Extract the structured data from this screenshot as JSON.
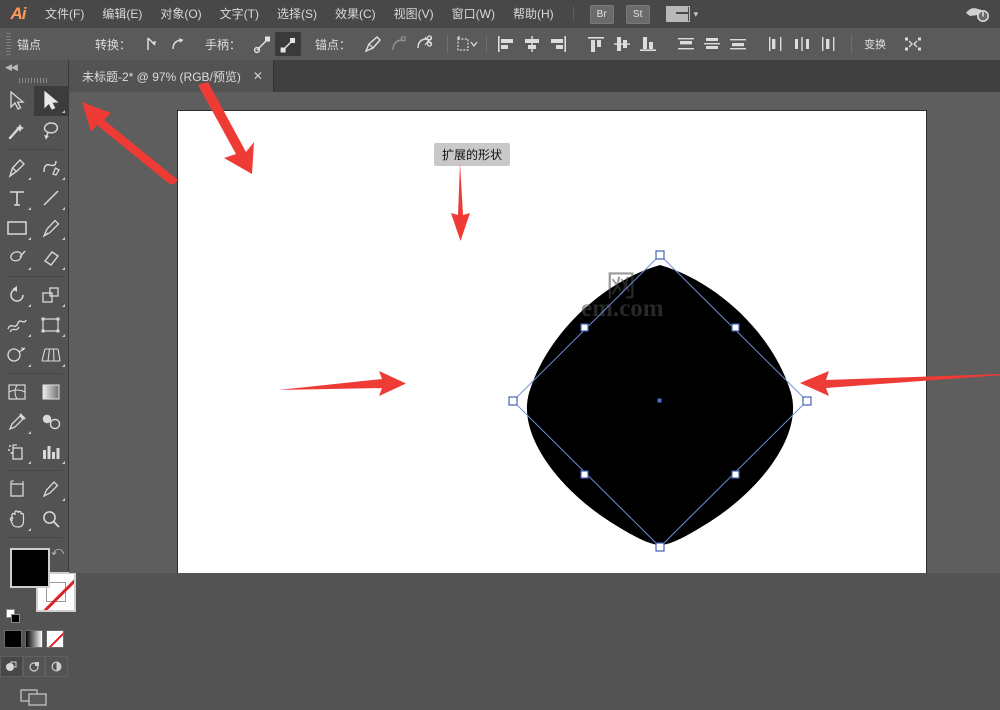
{
  "app": {
    "name": "Adobe Illustrator",
    "logo_text": "Ai"
  },
  "menubar": {
    "items": [
      {
        "label": "文件(F)",
        "name": "menu-file"
      },
      {
        "label": "编辑(E)",
        "name": "menu-edit"
      },
      {
        "label": "对象(O)",
        "name": "menu-object"
      },
      {
        "label": "文字(T)",
        "name": "menu-type"
      },
      {
        "label": "选择(S)",
        "name": "menu-select"
      },
      {
        "label": "效果(C)",
        "name": "menu-effect"
      },
      {
        "label": "视图(V)",
        "name": "menu-view"
      },
      {
        "label": "窗口(W)",
        "name": "menu-window"
      },
      {
        "label": "帮助(H)",
        "name": "menu-help"
      }
    ],
    "bridge_label": "Br",
    "stock_label": "St",
    "workspace_icon": "workspace-layout-icon",
    "chevron": "▾",
    "cloud_icon": "cloud-sync-icon"
  },
  "controlbar": {
    "selection_label": "锚点",
    "convert_label": "转换：",
    "handles_label": "手柄：",
    "anchor_label": "锚点：",
    "convert_tools": [
      "convert-to-corner-icon",
      "convert-to-smooth-icon"
    ],
    "handle_tools": [
      "show-handles-icon",
      "hide-handles-icon"
    ],
    "anchor_tools": [
      "remove-anchor-icon",
      "connect-anchor-icon",
      "cut-path-icon"
    ],
    "isolate_icon": "isolate-selected-icon",
    "align_horizontal": [
      "align-left-icon",
      "align-horizontal-center-icon",
      "align-right-icon"
    ],
    "align_vertical": [
      "align-top-icon",
      "align-vertical-center-icon",
      "align-bottom-icon"
    ],
    "distribute_vertical": [
      "distribute-top-icon",
      "distribute-vertical-center-icon",
      "distribute-bottom-icon"
    ],
    "distribute_horizontal": [
      "distribute-left-icon",
      "distribute-horizontal-center-icon",
      "distribute-right-icon"
    ],
    "transform_label": "变换",
    "reshape_icon": "reshape-icon"
  },
  "tabs": [
    {
      "label": "未标题-2* @ 97% (RGB/预览)",
      "close": "✕",
      "active": true
    }
  ],
  "toolbar": {
    "collapse_chevron": "◀◀",
    "tools": [
      [
        {
          "name": "selection-tool",
          "active": false
        },
        {
          "name": "direct-selection-tool",
          "active": true
        }
      ],
      [
        {
          "name": "magic-wand-tool",
          "active": false
        },
        {
          "name": "lasso-tool",
          "active": false
        }
      ],
      [
        {
          "name": "pen-tool",
          "active": false
        },
        {
          "name": "curvature-tool",
          "active": false
        }
      ],
      [
        {
          "name": "type-tool",
          "active": false
        },
        {
          "name": "line-segment-tool",
          "active": false
        }
      ],
      [
        {
          "name": "rectangle-tool",
          "active": false
        },
        {
          "name": "paintbrush-tool",
          "active": false
        }
      ],
      [
        {
          "name": "blob-brush-tool",
          "active": false
        },
        {
          "name": "eraser-tool",
          "active": false
        }
      ],
      [
        {
          "name": "rotate-tool",
          "active": false
        },
        {
          "name": "scale-tool",
          "active": false
        }
      ],
      [
        {
          "name": "width-tool",
          "active": false
        },
        {
          "name": "free-transform-tool",
          "active": false
        }
      ],
      [
        {
          "name": "shape-builder-tool",
          "active": false
        },
        {
          "name": "perspective-grid-tool",
          "active": false
        }
      ],
      [
        {
          "name": "mesh-tool",
          "active": false
        },
        {
          "name": "gradient-tool",
          "active": false
        }
      ],
      [
        {
          "name": "eyedropper-tool",
          "active": false
        },
        {
          "name": "blend-tool",
          "active": false
        }
      ],
      [
        {
          "name": "symbol-sprayer-tool",
          "active": false
        },
        {
          "name": "column-graph-tool",
          "active": false
        }
      ],
      [
        {
          "name": "artboard-tool",
          "active": false
        },
        {
          "name": "slice-tool",
          "active": false
        }
      ],
      [
        {
          "name": "hand-tool",
          "active": false
        },
        {
          "name": "zoom-tool",
          "active": false
        }
      ]
    ],
    "fill_color": "#000000",
    "stroke_color": "none",
    "swap_icon": "swap-fill-stroke-icon",
    "color_modes": [
      "color-solid-icon",
      "gradient-icon",
      "none-icon"
    ],
    "draw_modes": [
      "draw-normal-icon",
      "draw-behind-icon",
      "draw-inside-icon"
    ],
    "screen_mode": "change-screen-mode-icon"
  },
  "canvas": {
    "zoom_level": "97%",
    "artboard_bg": "#ffffff",
    "shape": {
      "fill": "#000000",
      "name": "expanded-rounded-diamond",
      "selection_color": "#6f8fd8"
    },
    "watermark": {
      "line1": "网",
      "line2": "em.com"
    },
    "annotations": [
      {
        "name": "expanded-shape-label",
        "text": "扩展的形状"
      }
    ],
    "arrow_color": "#ef3b36"
  }
}
